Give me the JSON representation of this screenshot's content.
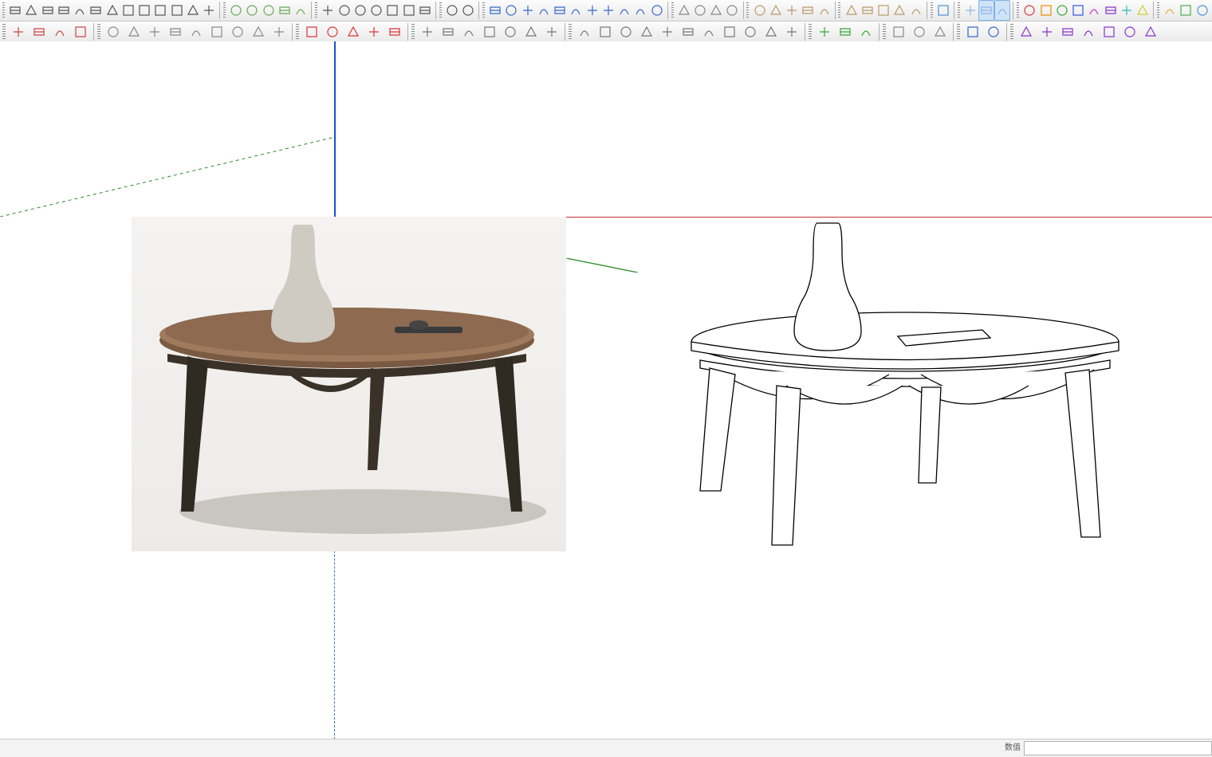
{
  "status": {
    "hint": "",
    "vcb_label": "数值",
    "vcb_value": ""
  },
  "toolbar": {
    "row1": {
      "groups": [
        {
          "icons": [
            "select",
            "layers",
            "line",
            "arc",
            "freehand",
            "rect",
            "circle",
            "polygon",
            "eraser",
            "tape",
            "paint",
            "protractor",
            "text"
          ]
        },
        {
          "icons": [
            "pushpull",
            "move",
            "rotate",
            "scale",
            "offset"
          ]
        },
        {
          "icons": [
            "followme",
            "outershell",
            "intersect",
            "union",
            "subtract",
            "trim",
            "split"
          ]
        },
        {
          "icons": [
            "flip",
            "mirror"
          ]
        },
        {
          "icons": [
            "orbit",
            "pan",
            "zoom",
            "zoom-extents",
            "zoom-window",
            "previous",
            "next",
            "position-camera",
            "look",
            "walk",
            "section"
          ]
        },
        {
          "icons": [
            "hide",
            "unhide",
            "xray",
            "wire"
          ]
        },
        {
          "icons": [
            "component-a",
            "component-b",
            "component-c",
            "component-d",
            "component-e"
          ]
        },
        {
          "icons": [
            "scene-add",
            "scene-update",
            "scene-prev",
            "scene-next",
            "scene-list"
          ]
        },
        {
          "icons": [
            "arrow-right"
          ]
        },
        {
          "icons": [
            "box-a",
            "box-b",
            "box-c"
          ],
          "active": [
            1,
            2
          ]
        },
        {
          "icons": [
            "color-red",
            "color-orange",
            "color-green",
            "color-blue",
            "color-magenta",
            "color-purple",
            "color-cyan",
            "color-yellow"
          ]
        },
        {
          "icons": [
            "cube-a",
            "cube-b",
            "cube-c"
          ]
        }
      ]
    },
    "row2": {
      "groups": [
        {
          "icons": [
            "plugin-a",
            "plugin-b",
            "plugin-c",
            "plugin-d"
          ]
        },
        {
          "icons": [
            "curve-a",
            "curve-b",
            "curve-c",
            "curve-d",
            "curve-e",
            "curve-f",
            "curve-g",
            "curve-h",
            "curve-i"
          ]
        },
        {
          "icons": [
            "dim-a",
            "dim-b",
            "dim-c",
            "dim-d",
            "dim-e"
          ]
        },
        {
          "icons": [
            "solid-a",
            "solid-b",
            "solid-c",
            "solid-d",
            "solid-e",
            "solid-f",
            "solid-g"
          ]
        },
        {
          "icons": [
            "tex-a",
            "tex-b",
            "tex-c",
            "tex-d",
            "tex-e",
            "tex-f",
            "tex-g",
            "tex-h",
            "tex-i",
            "tex-j",
            "tex-k"
          ]
        },
        {
          "icons": [
            "env-a",
            "env-b",
            "env-c"
          ]
        },
        {
          "icons": [
            "poly-a",
            "poly-b",
            "poly-c"
          ]
        },
        {
          "icons": [
            "grid-a",
            "grid-b"
          ]
        },
        {
          "icons": [
            "bz-a",
            "bz-b",
            "bz-c",
            "bz-d",
            "bz-e",
            "bz-f",
            "bz-g"
          ]
        }
      ]
    }
  },
  "icon_tint": {
    "select": "#555",
    "layers": "#555",
    "line": "#555",
    "arc": "#555",
    "freehand": "#555",
    "rect": "#555",
    "circle": "#555",
    "polygon": "#555",
    "eraser": "#555",
    "tape": "#555",
    "paint": "#555",
    "protractor": "#555",
    "text": "#555",
    "pushpull": "#6a5",
    "move": "#6a5",
    "rotate": "#6a5",
    "scale": "#6a5",
    "offset": "#6a5",
    "followme": "#555",
    "outershell": "#555",
    "intersect": "#555",
    "union": "#555",
    "subtract": "#555",
    "trim": "#555",
    "split": "#555",
    "flip": "#555",
    "mirror": "#555",
    "orbit": "#36c",
    "pan": "#36c",
    "zoom": "#36c",
    "zoom-extents": "#36c",
    "zoom-window": "#36c",
    "previous": "#36c",
    "next": "#36c",
    "position-camera": "#36c",
    "look": "#36c",
    "walk": "#36c",
    "section": "#36c",
    "hide": "#888",
    "unhide": "#888",
    "xray": "#888",
    "wire": "#888",
    "component-a": "#b96",
    "component-b": "#b96",
    "component-c": "#b96",
    "component-d": "#b96",
    "component-e": "#b96",
    "scene-add": "#b96",
    "scene-update": "#b96",
    "scene-prev": "#b96",
    "scene-next": "#b96",
    "scene-list": "#b96",
    "arrow-right": "#4a90d9",
    "box-a": "#8ab4e8",
    "box-b": "#8ab4e8",
    "box-c": "#8ab4e8",
    "color-red": "#d33",
    "color-orange": "#e80",
    "color-green": "#3a3",
    "color-blue": "#35d",
    "color-magenta": "#c3c",
    "color-purple": "#83c",
    "color-cyan": "#3bb",
    "color-yellow": "#cc3",
    "cube-a": "#e2b13c",
    "cube-b": "#4aad4a",
    "cube-c": "#4a90d9",
    "plugin-a": "#c44",
    "plugin-b": "#c44",
    "plugin-c": "#c44",
    "plugin-d": "#c44",
    "curve-a": "#888",
    "curve-b": "#888",
    "curve-c": "#888",
    "curve-d": "#888",
    "curve-e": "#888",
    "curve-f": "#888",
    "curve-g": "#888",
    "curve-h": "#888",
    "curve-i": "#888",
    "dim-a": "#d33",
    "dim-b": "#d33",
    "dim-c": "#d33",
    "dim-d": "#d33",
    "dim-e": "#d33",
    "solid-a": "#777",
    "solid-b": "#777",
    "solid-c": "#777",
    "solid-d": "#777",
    "solid-e": "#777",
    "solid-f": "#777",
    "solid-g": "#777",
    "tex-a": "#777",
    "tex-b": "#777",
    "tex-c": "#777",
    "tex-d": "#777",
    "tex-e": "#777",
    "tex-f": "#777",
    "tex-g": "#777",
    "tex-h": "#777",
    "tex-i": "#777",
    "tex-j": "#777",
    "tex-k": "#777",
    "env-a": "#3a3",
    "env-b": "#3a3",
    "env-c": "#3a3",
    "poly-a": "#888",
    "poly-b": "#888",
    "poly-c": "#888",
    "grid-a": "#36c",
    "grid-b": "#36c",
    "bz-a": "#83c",
    "bz-b": "#83c",
    "bz-c": "#83c",
    "bz-d": "#83c",
    "bz-e": "#83c",
    "bz-f": "#83c",
    "bz-g": "#83c"
  }
}
